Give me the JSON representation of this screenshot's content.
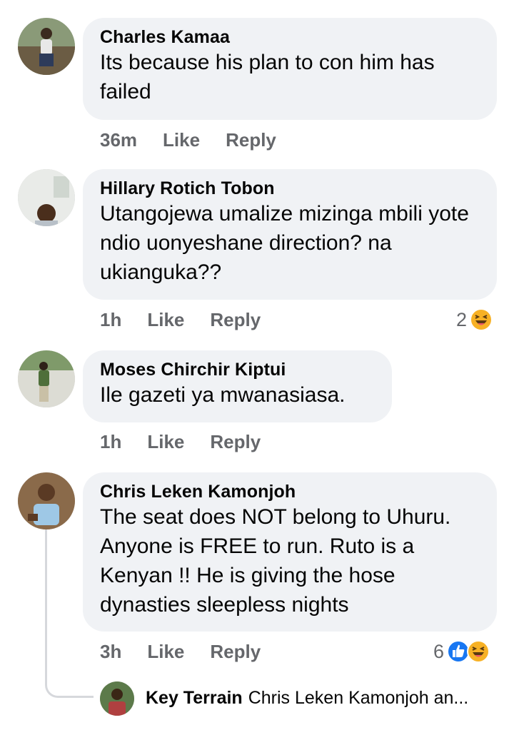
{
  "comments": [
    {
      "author": "Charles Kamaa",
      "text": "Its because his plan to con him has failed",
      "time": "36m",
      "like": "Like",
      "reply": "Reply"
    },
    {
      "author": "Hillary Rotich Tobon",
      "text": "Utangojewa umalize mizinga  mbili yote ndio uonyeshane direction? na ukianguka??",
      "time": "1h",
      "like": "Like",
      "reply": "Reply",
      "reaction_count": "2",
      "reaction_icons": [
        "haha-icon"
      ]
    },
    {
      "author": "Moses Chirchir Kiptui",
      "text": "Ile gazeti ya mwanasiasa.",
      "time": "1h",
      "like": "Like",
      "reply": "Reply"
    },
    {
      "author": "Chris Leken Kamonjoh",
      "text": "The seat does NOT belong to Uhuru. Anyone is FREE to run. Ruto is a Kenyan !! He is giving the hose dynasties sleepless nights",
      "time": "3h",
      "like": "Like",
      "reply": "Reply",
      "reaction_count": "6",
      "reaction_icons": [
        "like-icon",
        "haha-icon"
      ]
    }
  ],
  "reply_preview": {
    "author": "Key Terrain",
    "text": "Chris Leken Kamonjoh an..."
  },
  "colors": {
    "bubble": "#f0f2f5",
    "meta": "#65676b",
    "like_blue": "#1877f2",
    "haha_yellow": "#f7b125"
  }
}
